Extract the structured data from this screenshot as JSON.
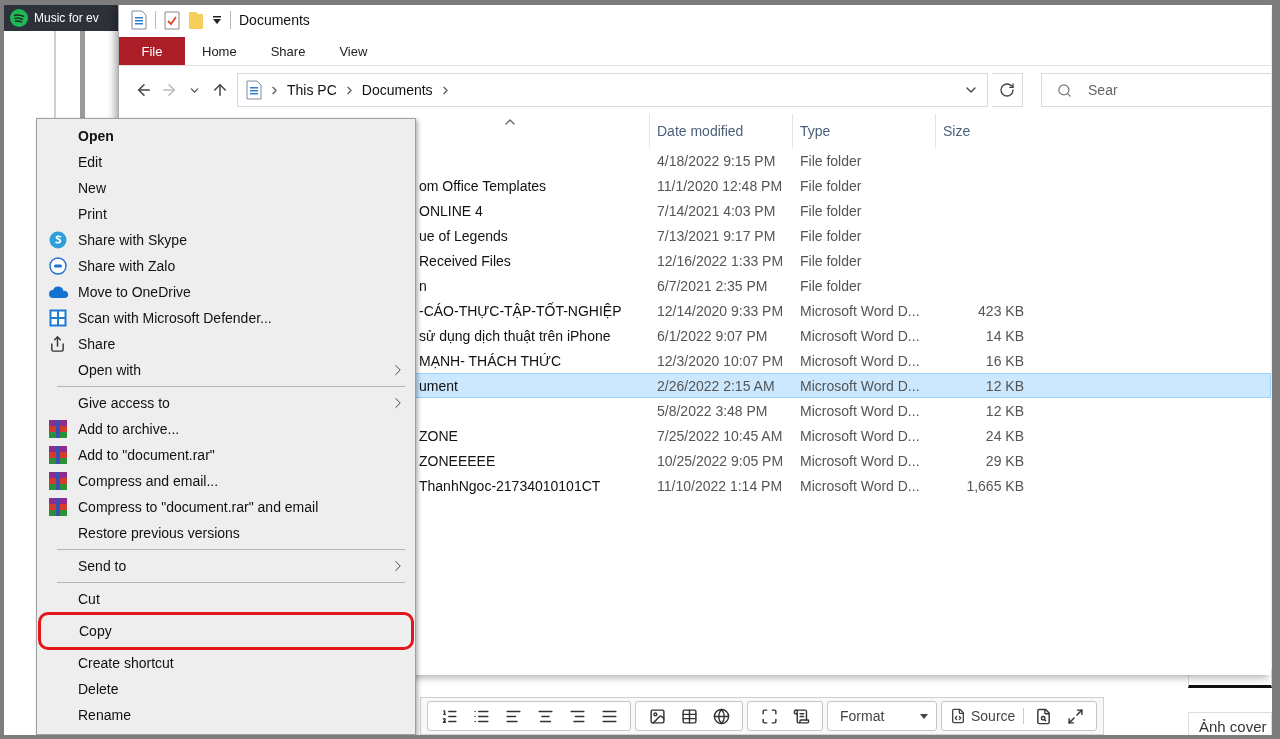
{
  "background_page": {
    "header_title": "Music for ev",
    "editor_toolbar": {
      "format_label": "Format",
      "source_label": "Source"
    },
    "side_label": "Ảnh cover"
  },
  "explorer": {
    "title": "Documents",
    "ribbon_tabs": [
      {
        "label": "File",
        "kind": "file"
      },
      {
        "label": "Home",
        "kind": "tab"
      },
      {
        "label": "Share",
        "kind": "tab"
      },
      {
        "label": "View",
        "kind": "tab"
      }
    ],
    "address": {
      "crumbs": [
        "This PC",
        "Documents"
      ]
    },
    "search": {
      "placeholder": "Sear"
    },
    "columns": [
      "Date modified",
      "Type",
      "Size"
    ],
    "rows": [
      {
        "date": "4/18/2022 9:15 PM",
        "type": "File folder",
        "selected": false
      },
      {
        "name": "om Office Templates",
        "date": "11/1/2020 12:48 PM",
        "type": "File folder",
        "selected": false
      },
      {
        "name": "ONLINE 4",
        "date": "7/14/2021 4:03 PM",
        "type": "File folder",
        "selected": false
      },
      {
        "name": "ue of Legends",
        "date": "7/13/2021 9:17 PM",
        "type": "File folder",
        "selected": false
      },
      {
        "name": "Received Files",
        "date": "12/16/2022 1:33 PM",
        "type": "File folder",
        "selected": false
      },
      {
        "name": "n",
        "date": "6/7/2021 2:35 PM",
        "type": "File folder",
        "selected": false
      },
      {
        "name": "-CÁO-THỰC-TẬP-TỐT-NGHIỆP",
        "date": "12/14/2020 9:33 PM",
        "type": "Microsoft Word D...",
        "size": "423 KB",
        "selected": false
      },
      {
        "name": "sử dụng dịch thuật trên iPhone",
        "date": "6/1/2022 9:07 PM",
        "type": "Microsoft Word D...",
        "size": "14 KB",
        "selected": false
      },
      {
        "name": "MẠNH- THÁCH THỨC",
        "date": "12/3/2020 10:07 PM",
        "type": "Microsoft Word D...",
        "size": "16 KB",
        "selected": false
      },
      {
        "name": "ument",
        "date": "2/26/2022 2:15 AM",
        "type": "Microsoft Word D...",
        "size": "12 KB",
        "selected": true
      },
      {
        "date": "5/8/2022 3:48 PM",
        "type": "Microsoft Word D...",
        "size": "12 KB",
        "selected": false
      },
      {
        "name": "ZONE",
        "date": "7/25/2022 10:45 AM",
        "type": "Microsoft Word D...",
        "size": "24 KB",
        "selected": false
      },
      {
        "name": "ZONEEEEE",
        "date": "10/25/2022 9:05 PM",
        "type": "Microsoft Word D...",
        "size": "29 KB",
        "selected": false
      },
      {
        "name": "ThanhNgoc-21734010101CT",
        "date": "11/10/2022 1:14 PM",
        "type": "Microsoft Word D...",
        "size": "1,665 KB",
        "selected": false
      }
    ]
  },
  "context_menu": {
    "sections": [
      [
        {
          "label": "Open",
          "kind": "default",
          "highlighted": false
        },
        {
          "label": "Edit",
          "kind": "plain",
          "highlighted": false
        },
        {
          "label": "New",
          "kind": "plain",
          "highlighted": false
        },
        {
          "label": "Print",
          "kind": "plain",
          "highlighted": false
        },
        {
          "label": "Share with Skype",
          "kind": "skype",
          "highlighted": false
        },
        {
          "label": "Share with Zalo",
          "kind": "zalo",
          "highlighted": false
        },
        {
          "label": "Move to OneDrive",
          "kind": "onedrive",
          "highlighted": false
        },
        {
          "label": "Scan with Microsoft Defender...",
          "kind": "defender",
          "highlighted": false
        },
        {
          "label": "Share",
          "kind": "share",
          "highlighted": false
        },
        {
          "label": "Open with",
          "kind": "submenu",
          "highlighted": false
        }
      ],
      [
        {
          "label": "Give access to",
          "kind": "submenu",
          "highlighted": false
        },
        {
          "label": "Add to archive...",
          "kind": "winrar",
          "highlighted": false
        },
        {
          "label": "Add to \"document.rar\"",
          "kind": "winrar",
          "highlighted": false
        },
        {
          "label": "Compress and email...",
          "kind": "winrar",
          "highlighted": false
        },
        {
          "label": "Compress to \"document.rar\" and email",
          "kind": "winrar",
          "highlighted": false
        },
        {
          "label": "Restore previous versions",
          "kind": "plain",
          "highlighted": false
        }
      ],
      [
        {
          "label": "Send to",
          "kind": "submenu",
          "highlighted": false
        }
      ],
      [
        {
          "label": "Cut",
          "kind": "plain",
          "highlighted": false
        },
        {
          "label": "Copy",
          "kind": "plain",
          "highlighted": true
        },
        {
          "label": "Create shortcut",
          "kind": "plain",
          "highlighted": false
        },
        {
          "label": "Delete",
          "kind": "plain",
          "highlighted": false
        },
        {
          "label": "Rename",
          "kind": "plain",
          "highlighted": false
        }
      ]
    ]
  }
}
